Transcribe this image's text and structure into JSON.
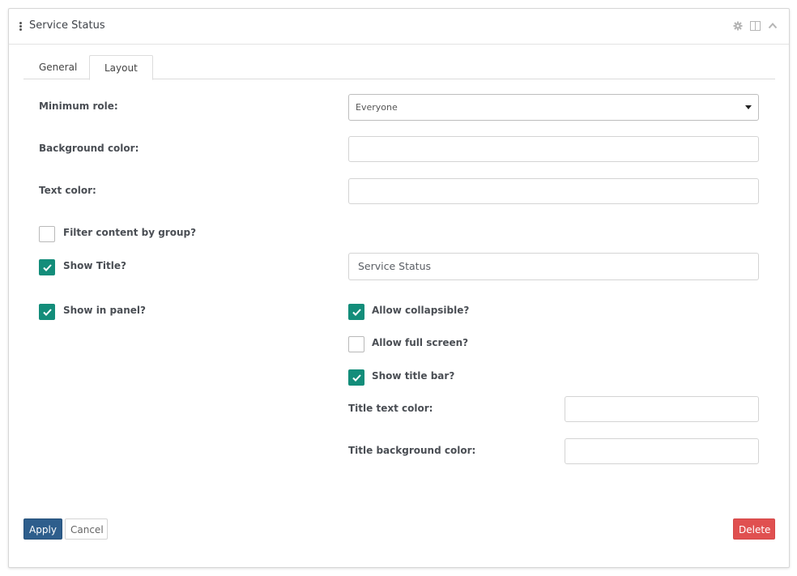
{
  "panel": {
    "title": "Service Status",
    "header_icons": [
      "gear-icon",
      "split-view-icon",
      "chevron-up-icon"
    ]
  },
  "tabs": [
    {
      "label": "General",
      "active": false
    },
    {
      "label": "Layout",
      "active": true
    }
  ],
  "form": {
    "minimum_role": {
      "label": "Minimum role:",
      "value": "Everyone"
    },
    "background_color": {
      "label": "Background color:",
      "value": ""
    },
    "text_color": {
      "label": "Text color:",
      "value": ""
    },
    "filter_by_group": {
      "label": "Filter content by group?",
      "checked": false
    },
    "show_title": {
      "label": "Show Title?",
      "checked": true,
      "title_value": "Service Status"
    },
    "show_in_panel": {
      "label": "Show in panel?",
      "checked": true
    },
    "allow_collapsible": {
      "label": "Allow collapsible?",
      "checked": true
    },
    "allow_full_screen": {
      "label": "Allow full screen?",
      "checked": false
    },
    "show_title_bar": {
      "label": "Show title bar?",
      "checked": true
    },
    "title_text_color": {
      "label": "Title text color:",
      "value": ""
    },
    "title_background_color": {
      "label": "Title background color:",
      "value": ""
    }
  },
  "buttons": {
    "apply": "Apply",
    "cancel": "Cancel",
    "delete": "Delete"
  },
  "colors": {
    "accent_checkbox": "#138d7a",
    "apply_button": "#2e5e8c",
    "delete_button": "#e05050"
  }
}
